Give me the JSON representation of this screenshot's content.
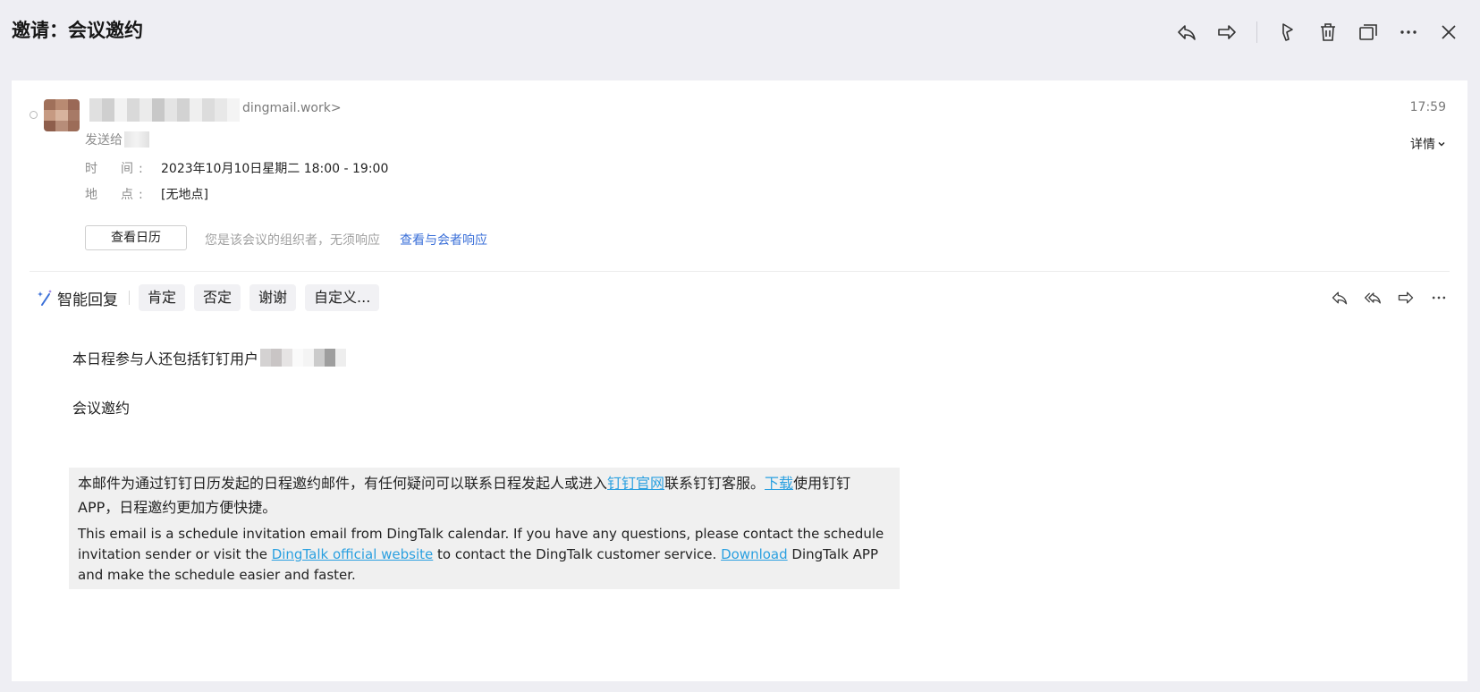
{
  "header": {
    "title": "邀请：会议邀约"
  },
  "toolbar": {
    "icons": [
      "reply-icon",
      "forward-icon",
      "flag-icon",
      "trash-icon",
      "new-window-icon",
      "more-icon",
      "close-icon"
    ]
  },
  "message": {
    "sender_email_visible": "dingmail.work>",
    "send_to_label": "发送给",
    "time": "17:59",
    "details_label": "详情",
    "time_label": "时　间:",
    "time_value": "2023年10月10日星期二 18:00 - 19:00",
    "location_label": "地　点:",
    "location_value": "[无地点]",
    "view_calendar_button": "查看日历",
    "organizer_note": "您是该会议的组织者，无须响应",
    "view_responses_link": "查看与会者响应"
  },
  "smart_reply": {
    "label": "智能回复",
    "chips": [
      "肯定",
      "否定",
      "谢谢",
      "自定义..."
    ]
  },
  "body": {
    "participants_line": "本日程参与人还包括钉钉用户",
    "subject_line": "会议邀约"
  },
  "footer": {
    "zh_part1": "本邮件为通过钉钉日历发起的日程邀约邮件，有任何疑问可以联系日程发起人或进入",
    "zh_link1": "钉钉官网",
    "zh_part2": "联系钉钉客服。",
    "zh_link2": "下载",
    "zh_part3": "使用钉钉APP，日程邀约更加方便快捷。",
    "en_part1": "This email is a schedule invitation email from DingTalk calendar. If you have any questions, please contact the schedule invitation sender or visit the ",
    "en_link1": "DingTalk official website",
    "en_part2": "  to contact the DingTalk customer service. ",
    "en_link2": "Download",
    "en_part3": " DingTalk APP and make the schedule easier and faster."
  },
  "colors": {
    "link": "#2aa0e0",
    "accent_link": "#3a6fd8",
    "background": "#eeeef3"
  }
}
